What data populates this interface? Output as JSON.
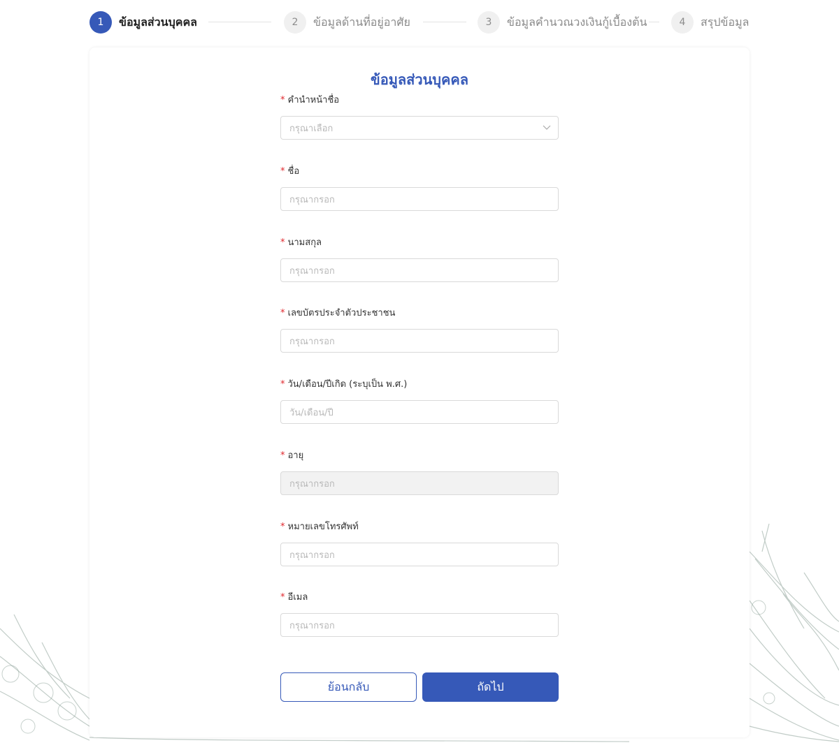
{
  "stepper": {
    "steps": [
      {
        "number": "1",
        "label": "ข้อมูลส่วนบุคคล",
        "active": true
      },
      {
        "number": "2",
        "label": "ข้อมูลด้านที่อยู่อาศัย",
        "active": false
      },
      {
        "number": "3",
        "label": "ข้อมูลคำนวณวงเงินกู้เบื้องต้น",
        "active": false
      },
      {
        "number": "4",
        "label": "สรุปข้อมูล",
        "active": false
      }
    ]
  },
  "form": {
    "title": "ข้อมูลส่วนบุคคล",
    "required_mark": "*",
    "fields": [
      {
        "label": "คำนำหน้าชื่อ",
        "placeholder": "กรุณาเลือก",
        "type": "select"
      },
      {
        "label": "ชื่อ",
        "placeholder": "กรุณากรอก",
        "type": "text"
      },
      {
        "label": "นามสกุล",
        "placeholder": "กรุณากรอก",
        "type": "text"
      },
      {
        "label": "เลขบัตรประจำตัวประชาชน",
        "placeholder": "กรุณากรอก",
        "type": "text"
      },
      {
        "label": "วัน/เดือน/ปีเกิด (ระบุเป็น พ.ศ.)",
        "placeholder": "วัน/เดือน/ปี",
        "type": "date"
      },
      {
        "label": "อายุ",
        "placeholder": "กรุณากรอก",
        "type": "disabled"
      },
      {
        "label": "หมายเลขโทรศัพท์",
        "placeholder": "กรุณากรอก",
        "type": "text"
      },
      {
        "label": "อีเมล",
        "placeholder": "กรุณากรอก",
        "type": "text"
      }
    ]
  },
  "buttons": {
    "back_label": "ย้อนกลับ",
    "next_label": "ถัดไป"
  },
  "colors": {
    "primary": "#3659b8",
    "required": "#e0282e",
    "border": "#d9d9d9",
    "disabled_bg": "#f2f2f2"
  }
}
